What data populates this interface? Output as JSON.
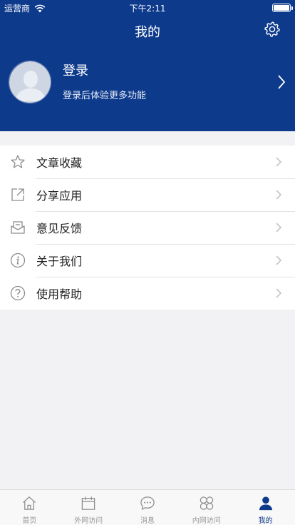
{
  "status_bar": {
    "carrier": "运营商",
    "time": "下午2:11"
  },
  "header": {
    "title": "我的"
  },
  "profile": {
    "login_label": "登录",
    "subtitle": "登录后体验更多功能"
  },
  "menu": [
    {
      "label": "文章收藏",
      "icon": "star-icon"
    },
    {
      "label": "分享应用",
      "icon": "share-icon"
    },
    {
      "label": "意见反馈",
      "icon": "feedback-icon"
    },
    {
      "label": "关于我们",
      "icon": "info-icon"
    },
    {
      "label": "使用帮助",
      "icon": "help-icon"
    }
  ],
  "tabs": [
    {
      "label": "首页",
      "icon": "home-icon"
    },
    {
      "label": "外网访问",
      "icon": "calendar-icon"
    },
    {
      "label": "消息",
      "icon": "message-icon"
    },
    {
      "label": "内网访问",
      "icon": "clover-icon"
    },
    {
      "label": "我的",
      "icon": "user-icon",
      "active": true
    }
  ],
  "colors": {
    "brand": "#0e3a8c",
    "background": "#f2f2f4",
    "inactive_tab": "#999999"
  }
}
